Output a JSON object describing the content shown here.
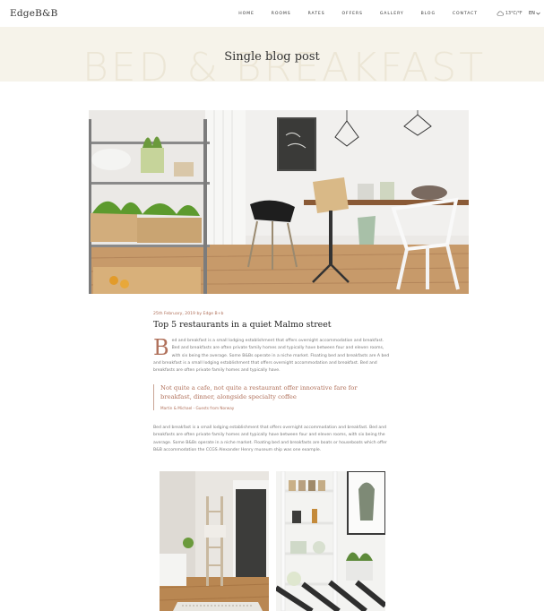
{
  "header": {
    "logo": "EdgeB&B",
    "nav": [
      "HOME",
      "ROOMS",
      "RATES",
      "OFFERS",
      "GALLERY",
      "BLOG",
      "CONTACT"
    ],
    "weather": "13°C/°F",
    "language": "EN"
  },
  "band": {
    "watermark": "BED & BREAKFAST",
    "title": "Single blog post"
  },
  "post": {
    "meta": "25th February, 2019 by Edge B+b",
    "title": "Top 5 restaurants in a quiet Malmo street",
    "dropcap": "B",
    "paragraph1": "ed and breakfast is a small lodging establishment that offers overnight accommodation and breakfast. Bed and breakfasts are often private family homes and typically have between four and eleven rooms, with six being the average. Some B&Bs operate in a niche market. Floating bed and breakfasts are A bed and breakfast is a small lodging establishment that offers overnight accommodation and breakfast. Bed and breakfasts are often private family homes and typically have.",
    "quote": "Not quite a cafe, not quite a restaurant offer innovative fare for breakfast, dinner, alongside specialty coffee",
    "quote_author": "Martin & Michael - Guests from Norway",
    "paragraph2": "Bed and breakfast is a small lodging establishment that offers overnight accommodation and breakfast. Bed and breakfasts are often private family homes and typically have between four and eleven rooms, with six being the average. Some B&Bs operate in a niche market. Floating bed and breakfasts are boats or houseboats which offer B&B accommodation the CCGS Alexander Henry museum ship was one example."
  },
  "colors": {
    "accent": "#b0705a",
    "band_bg": "#f6f3ea",
    "watermark": "#ece6d6"
  }
}
